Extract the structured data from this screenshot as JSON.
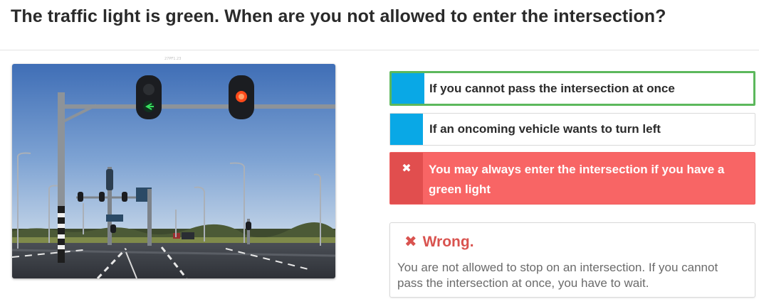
{
  "question": {
    "title": "The traffic light is green. When are you not allowed to enter the intersection?"
  },
  "photo": {
    "caption": "27PF1.23",
    "alt": "photo"
  },
  "answers": [
    {
      "label": "If you cannot pass the intersection at once",
      "state": "correct-highlighted"
    },
    {
      "label": "If an oncoming vehicle wants to turn left",
      "state": "neutral"
    },
    {
      "label": "You may always enter the intersection if you have a green light",
      "state": "selected-wrong",
      "marker_icon": "✖"
    }
  ],
  "feedback": {
    "icon": "✖",
    "title": "Wrong.",
    "text": "You are not allowed to stop on an intersection. If you cannot pass the intersection at once, you have to wait."
  },
  "colors": {
    "marker_blue": "#09a8e6",
    "correct_border": "#5cb85c",
    "wrong_bg": "#f86565",
    "wrong_marker": "#e14e4e",
    "wrong_text": "#d9534f"
  }
}
